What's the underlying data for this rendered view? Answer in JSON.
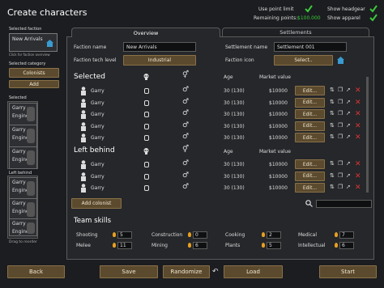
{
  "title": "Create characters",
  "options": {
    "use_point_limit": "Use point limit",
    "remaining_points": "Remaining points:",
    "remaining_value": "$100.000",
    "show_headgear": "Show headgear",
    "show_apparel": "Show apparel"
  },
  "sidebar": {
    "selected_faction": "Selected faction",
    "faction_name": "New Arrivals",
    "faction_hint": "Click for faction overview",
    "selected_category": "Selected category",
    "category_value": "Colonists",
    "add": "Add",
    "selected": "Selected",
    "left_behind": "Left behind",
    "drag_hint": "Drag to reorder",
    "selected_cards": [
      {
        "name": "Garry",
        "role": "Engineer"
      },
      {
        "name": "Garry",
        "role": "Engineer"
      },
      {
        "name": "Garry",
        "role": "Engineer"
      }
    ],
    "left_cards": [
      {
        "name": "Garry",
        "role": "Engineer"
      },
      {
        "name": "Garry",
        "role": "Engineer"
      },
      {
        "name": "Garry",
        "role": "Engineer"
      }
    ]
  },
  "tabs": {
    "overview": "Overview",
    "settlements": "Settlements"
  },
  "form": {
    "faction_name_label": "Faction name",
    "faction_name_value": "New Arrivals",
    "faction_tech_label": "Faction tech level",
    "faction_tech_value": "Industrial",
    "settlement_name_label": "Settlement name",
    "settlement_name_value": "Settlement 001",
    "faction_icon_label": "Faction icon",
    "faction_icon_button": "Select.."
  },
  "table": {
    "selected_header": "Selected",
    "left_behind_header": "Left behind",
    "age_header": "Age",
    "market_header": "Market value",
    "edit": "Edit...",
    "selected_rows": [
      {
        "name": "Garry",
        "age": "30 (130)",
        "value": "$10000"
      },
      {
        "name": "Garry",
        "age": "30 (130)",
        "value": "$10000"
      },
      {
        "name": "Garry",
        "age": "30 (130)",
        "value": "$10000"
      },
      {
        "name": "Garry",
        "age": "30 (130)",
        "value": "$10000"
      },
      {
        "name": "Garry",
        "age": "30 (130)",
        "value": "$10000"
      }
    ],
    "left_rows": [
      {
        "name": "Garry",
        "age": "30 (130)",
        "value": "$10000"
      },
      {
        "name": "Garry",
        "age": "30 (130)",
        "value": "$10000"
      },
      {
        "name": "Garry",
        "age": "30 (130)",
        "value": "$10000"
      }
    ]
  },
  "add_colonist": "Add colonist",
  "team_skills": {
    "title": "Team skills",
    "skills": [
      {
        "name": "Shooting",
        "value": "5"
      },
      {
        "name": "Construction",
        "value": "0"
      },
      {
        "name": "Cooking",
        "value": "2"
      },
      {
        "name": "Medical",
        "value": "7"
      },
      {
        "name": "Melee",
        "value": "11"
      },
      {
        "name": "Mining",
        "value": "6"
      },
      {
        "name": "Plants",
        "value": "5"
      },
      {
        "name": "Intellectual",
        "value": "6"
      }
    ]
  },
  "footer": {
    "back": "Back",
    "save": "Save",
    "randomize": "Randomize",
    "load": "Load",
    "start": "Start"
  },
  "colors": {
    "accent": "#8a7148",
    "check": "#3cc83c",
    "delete": "#d33"
  }
}
